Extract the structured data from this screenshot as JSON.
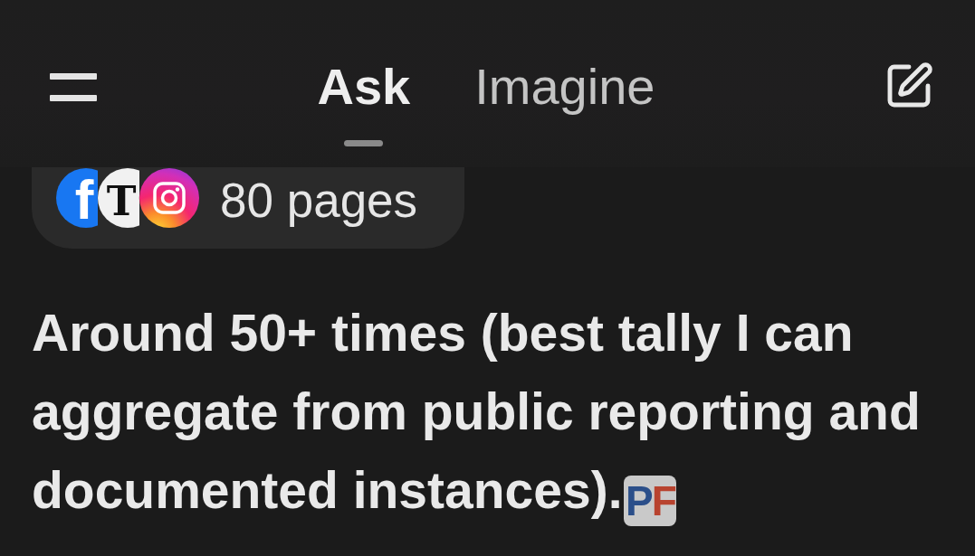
{
  "header": {
    "tabs": [
      {
        "label": "Ask",
        "selected": true
      },
      {
        "label": "Imagine",
        "selected": false
      }
    ]
  },
  "sources": {
    "icons": [
      {
        "kind": "facebook",
        "glyph": "f"
      },
      {
        "kind": "newspaper",
        "glyph": "T"
      },
      {
        "kind": "instagram"
      }
    ],
    "label": "80 pages"
  },
  "answer": {
    "text": "Around 50+ times (best tally I can aggregate from public reporting and documented instances).",
    "source_logo": {
      "letters": [
        {
          "text": "P",
          "color": "#2b4f8a"
        },
        {
          "text": "F",
          "color": "#b8432f"
        }
      ]
    }
  }
}
